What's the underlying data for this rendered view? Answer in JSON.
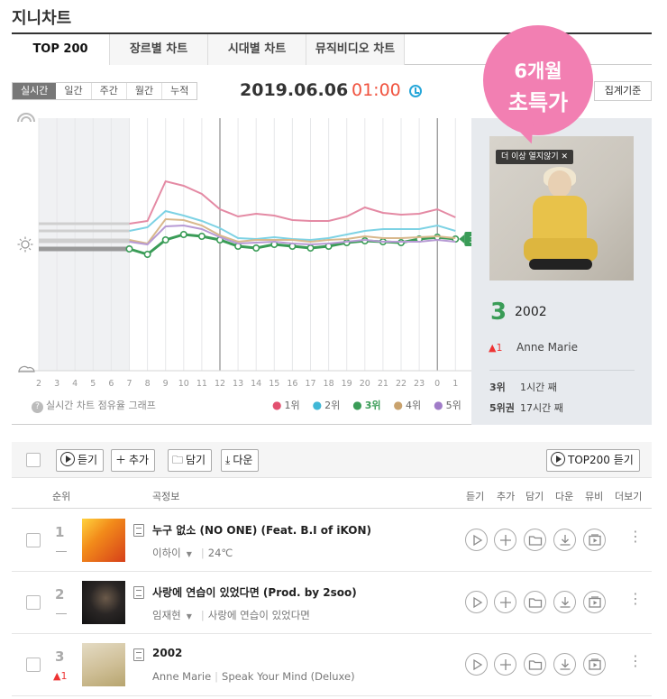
{
  "page_title": "지니차트",
  "tabs": [
    "TOP 200",
    "장르별 차트",
    "시대별 차트",
    "뮤직비디오 차트"
  ],
  "period_filters": [
    "실시간",
    "일간",
    "주간",
    "월간",
    "누적"
  ],
  "chart_date": "2019.06.06",
  "chart_time": "01:00",
  "criteria_button": "집계기준",
  "promo": {
    "line1": "6개월",
    "line2": "초특가"
  },
  "featured": {
    "badge": "더 이상 열지않기 ✕",
    "rank": "3",
    "title": "2002",
    "change": "▲1",
    "artist": "Anne Marie",
    "stat1_label": "3위",
    "stat1_value": "1시간 째",
    "stat2_label": "5위권",
    "stat2_value": "17시간 째"
  },
  "chart_help": "실시간 차트 점유율 그래프",
  "chart_data": {
    "type": "line",
    "x": [
      "2",
      "3",
      "4",
      "5",
      "6",
      "7",
      "8",
      "9",
      "10",
      "11",
      "12",
      "13",
      "14",
      "15",
      "16",
      "17",
      "18",
      "19",
      "20",
      "21",
      "22",
      "23",
      "0",
      "1"
    ],
    "current_label": "3위",
    "series": [
      {
        "name": "1위",
        "color": "#e48aa4",
        "start": 7,
        "values": [
          null,
          null,
          null,
          null,
          null,
          248,
          245,
          201,
          206,
          215,
          232,
          240,
          237,
          239,
          244,
          245,
          245,
          240,
          230,
          236,
          238,
          237,
          232,
          241
        ]
      },
      {
        "name": "2위",
        "color": "#7dd2e4",
        "start": 7,
        "values": [
          null,
          null,
          null,
          null,
          null,
          256,
          252,
          234,
          239,
          245,
          253,
          264,
          265,
          263,
          265,
          266,
          264,
          260,
          256,
          254,
          254,
          254,
          250,
          256
        ]
      },
      {
        "name": "3위",
        "color": "#3a9c57",
        "start": 7,
        "values": [
          null,
          null,
          null,
          null,
          null,
          276,
          282,
          266,
          260,
          262,
          266,
          273,
          275,
          271,
          273,
          275,
          273,
          269,
          267,
          268,
          269,
          265,
          263,
          265
        ]
      },
      {
        "name": "4위",
        "color": "#d8b88c",
        "start": 7,
        "values": [
          null,
          null,
          null,
          null,
          null,
          266,
          270,
          243,
          244,
          250,
          261,
          268,
          266,
          266,
          266,
          268,
          266,
          265,
          262,
          264,
          264,
          263,
          262,
          264
        ]
      },
      {
        "name": "5위",
        "color": "#b79ad4",
        "start": 7,
        "values": [
          null,
          null,
          null,
          null,
          null,
          268,
          271,
          251,
          250,
          254,
          263,
          270,
          269,
          268,
          270,
          271,
          270,
          268,
          266,
          268,
          268,
          268,
          266,
          268
        ]
      }
    ]
  },
  "toolbar": {
    "listen": "듣기",
    "add": "추가",
    "save": "담기",
    "download": "다운",
    "top200": "TOP200 듣기"
  },
  "list_headers": {
    "rank": "순위",
    "info": "곡정보",
    "listen": "듣기",
    "add": "추가",
    "save": "담기",
    "download": "다운",
    "mv": "뮤비",
    "more": "더보기"
  },
  "songs": [
    {
      "rank": "1",
      "change": "",
      "title": "누구 없소 (NO ONE) (Feat. B.I of iKON)",
      "artist": "이하이",
      "album": "24℃",
      "thumb_color": "#e9731c"
    },
    {
      "rank": "2",
      "change": "",
      "title": "사랑에 연습이 있었다면 (Prod. by 2soo)",
      "artist": "임재현",
      "album": "사랑에 연습이 있었다면",
      "thumb_color": "#2d2a2a"
    },
    {
      "rank": "3",
      "change": "▲1",
      "title": "2002",
      "artist": "Anne Marie",
      "album": "Speak Your Mind (Deluxe)",
      "thumb_color": "#d6c8a6"
    }
  ]
}
